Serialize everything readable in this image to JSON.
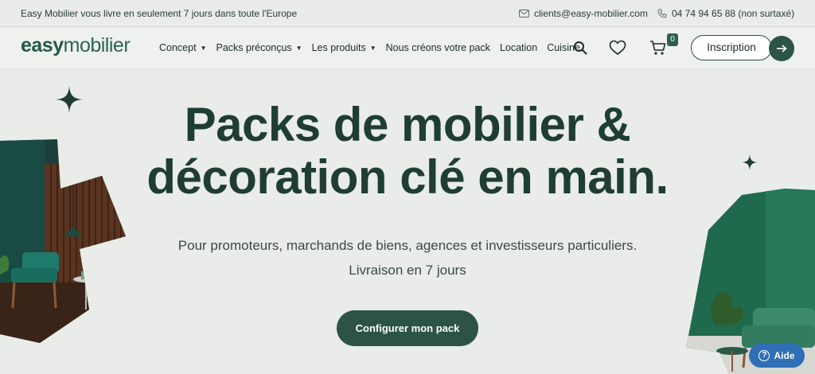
{
  "topbar": {
    "message": "Easy Mobilier vous livre en seulement 7 jours dans toute l'Europe",
    "email": "clients@easy-mobilier.com",
    "phone": "04 74 94 65 88 (non surtaxé)"
  },
  "logo": {
    "part1": "easy",
    "part2": "mobilier"
  },
  "menu": [
    {
      "label": "Concept",
      "caret": "▼"
    },
    {
      "label": "Packs préconçus",
      "caret": "▼"
    },
    {
      "label": "Les produits",
      "caret": "▼"
    },
    {
      "label": "Nous créons votre pack",
      "caret": ""
    },
    {
      "label": "Location",
      "caret": ""
    },
    {
      "label": "Cuisine",
      "caret": ""
    }
  ],
  "cart": {
    "count": "0"
  },
  "inscription_label": "Inscription",
  "hero": {
    "title_line1": "Packs de mobilier &",
    "title_line2": "décoration clé en main.",
    "subtitle_line1": "Pour promoteurs, marchands de biens, agences et investisseurs particuliers.",
    "subtitle_line2": "Livraison en 7 jours",
    "cta_label": "Configurer mon pack"
  },
  "help": {
    "label": "Aide"
  },
  "icons": {
    "email": "mail-icon",
    "phone": "phone-icon",
    "search": "search-icon",
    "wishlist": "heart-icon",
    "cart": "cart-icon",
    "arrow": "arrow-right-icon",
    "help": "question-icon"
  },
  "colors": {
    "brand": "#2b5346",
    "background": "#e9ece8",
    "help": "#2f6fb5"
  }
}
